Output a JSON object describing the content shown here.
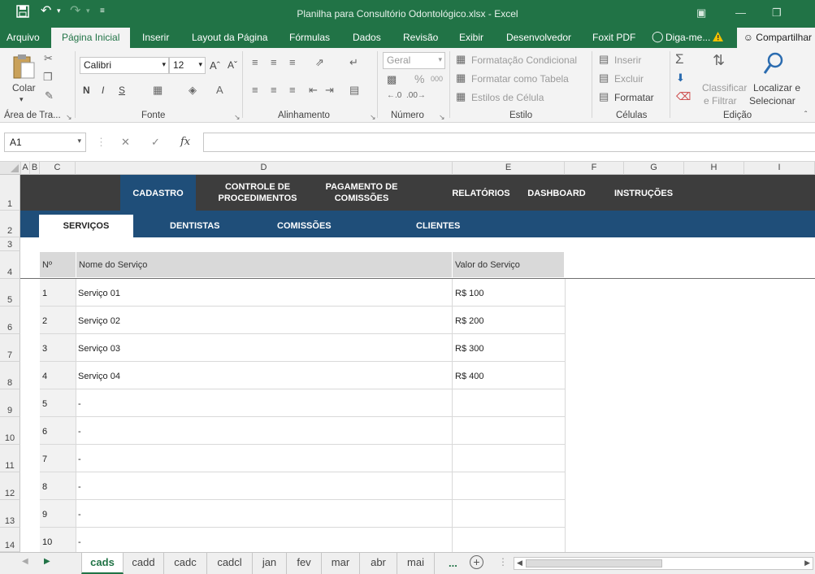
{
  "window": {
    "title": "Planilha para Consultório Odontológico.xlsx - Excel"
  },
  "ribbon_tabs": [
    "Arquivo",
    "Página Inicial",
    "Inserir",
    "Layout da Página",
    "Fórmulas",
    "Dados",
    "Revisão",
    "Exibir",
    "Desenvolvedor",
    "Foxit PDF",
    "Diga-me..."
  ],
  "share_label": "Compartilhar",
  "ribbon": {
    "clipboard": {
      "paste": "Colar",
      "label": "Área de Tra..."
    },
    "font": {
      "name": "Calibri",
      "size": "12",
      "bold": "N",
      "italic": "I",
      "underline": "S",
      "label": "Fonte"
    },
    "alignment": {
      "label": "Alinhamento"
    },
    "number": {
      "format": "Geral",
      "percent": "%",
      "thousands": "000",
      "label": "Número"
    },
    "style": {
      "conditional": "Formatação Condicional",
      "as_table": "Formatar como Tabela",
      "cell_styles": "Estilos de Célula",
      "label": "Estilo"
    },
    "cells": {
      "insert": "Inserir",
      "delete": "Excluir",
      "format": "Formatar",
      "label": "Células"
    },
    "editing": {
      "sort_1": "Classificar",
      "sort_2": "e Filtrar",
      "find_1": "Localizar e",
      "find_2": "Selecionar",
      "label": "Edição"
    }
  },
  "formula_bar": {
    "name_box": "A1",
    "fx": "fx",
    "formula": ""
  },
  "columns": [
    "A",
    "B",
    "C",
    "D",
    "E",
    "F",
    "G",
    "H",
    "I"
  ],
  "rows": [
    "1",
    "2",
    "3",
    "4",
    "5",
    "6",
    "7",
    "8",
    "9",
    "10",
    "11",
    "12",
    "13",
    "14"
  ],
  "sheet": {
    "nav_main": [
      "CADASTRO",
      "CONTROLE DE\nPROCEDIMENTOS",
      "PAGAMENTO DE\nCOMISSÕES",
      "RELATÓRIOS",
      "DASHBOARD",
      "INSTRUÇÕES"
    ],
    "nav_sub": [
      "SERVIÇOS",
      "DENTISTAS",
      "COMISSÕES",
      "CLIENTES"
    ],
    "headers": {
      "num": "Nº",
      "name": "Nome do Serviço",
      "value": "Valor do Serviço"
    },
    "rows": [
      {
        "num": "1",
        "name": "Serviço 01",
        "value": "R$ 100"
      },
      {
        "num": "2",
        "name": "Serviço 02",
        "value": "R$ 200"
      },
      {
        "num": "3",
        "name": "Serviço 03",
        "value": "R$ 300"
      },
      {
        "num": "4",
        "name": "Serviço 04",
        "value": "R$ 400"
      },
      {
        "num": "5",
        "name": "-",
        "value": ""
      },
      {
        "num": "6",
        "name": "-",
        "value": ""
      },
      {
        "num": "7",
        "name": "-",
        "value": ""
      },
      {
        "num": "8",
        "name": "-",
        "value": ""
      },
      {
        "num": "9",
        "name": "-",
        "value": ""
      },
      {
        "num": "10",
        "name": "-",
        "value": ""
      }
    ]
  },
  "sheet_tabs": [
    "cads",
    "cadd",
    "cadc",
    "cadcl",
    "jan",
    "fev",
    "mar",
    "abr",
    "mai"
  ],
  "sheet_tabs_more": "...",
  "colors": {
    "excel_green": "#217346",
    "nav_dark": "#3d3d3d",
    "nav_blue": "#1f4e79",
    "header_gray": "#d9d9d9"
  }
}
